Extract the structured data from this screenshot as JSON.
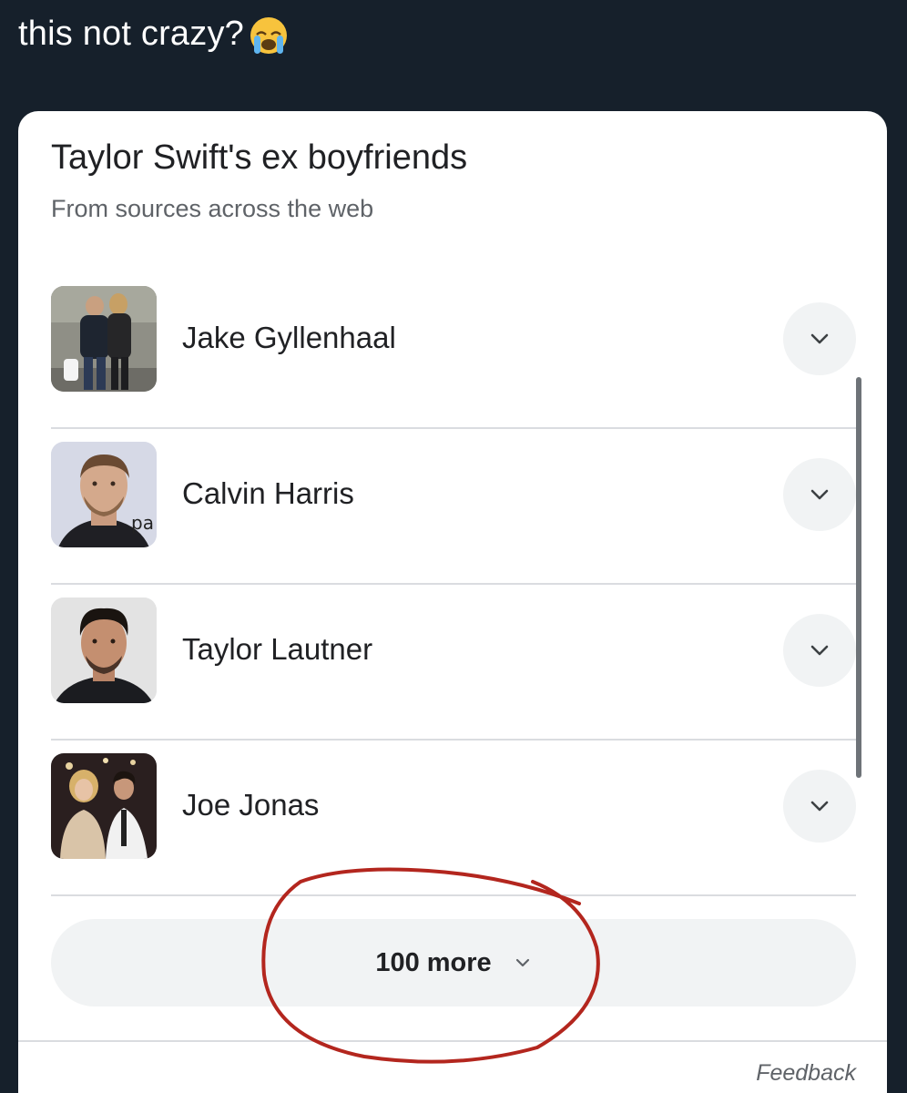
{
  "post": {
    "text": "this not crazy?",
    "emoji": "loudly-crying-face"
  },
  "card": {
    "title": "Taylor Swift's ex boyfriends",
    "subtitle": "From sources across the web",
    "items": [
      {
        "name": "Jake Gyllenhaal",
        "thumb": "couple-walking-photo"
      },
      {
        "name": "Calvin Harris",
        "thumb": "portrait-photo"
      },
      {
        "name": "Taylor Lautner",
        "thumb": "portrait-photo"
      },
      {
        "name": "Joe Jonas",
        "thumb": "couple-event-photo"
      }
    ],
    "more_label": "100 more",
    "feedback_label": "Feedback"
  },
  "colors": {
    "background": "#16202b",
    "card": "#ffffff",
    "annotation": "#b3261e"
  }
}
